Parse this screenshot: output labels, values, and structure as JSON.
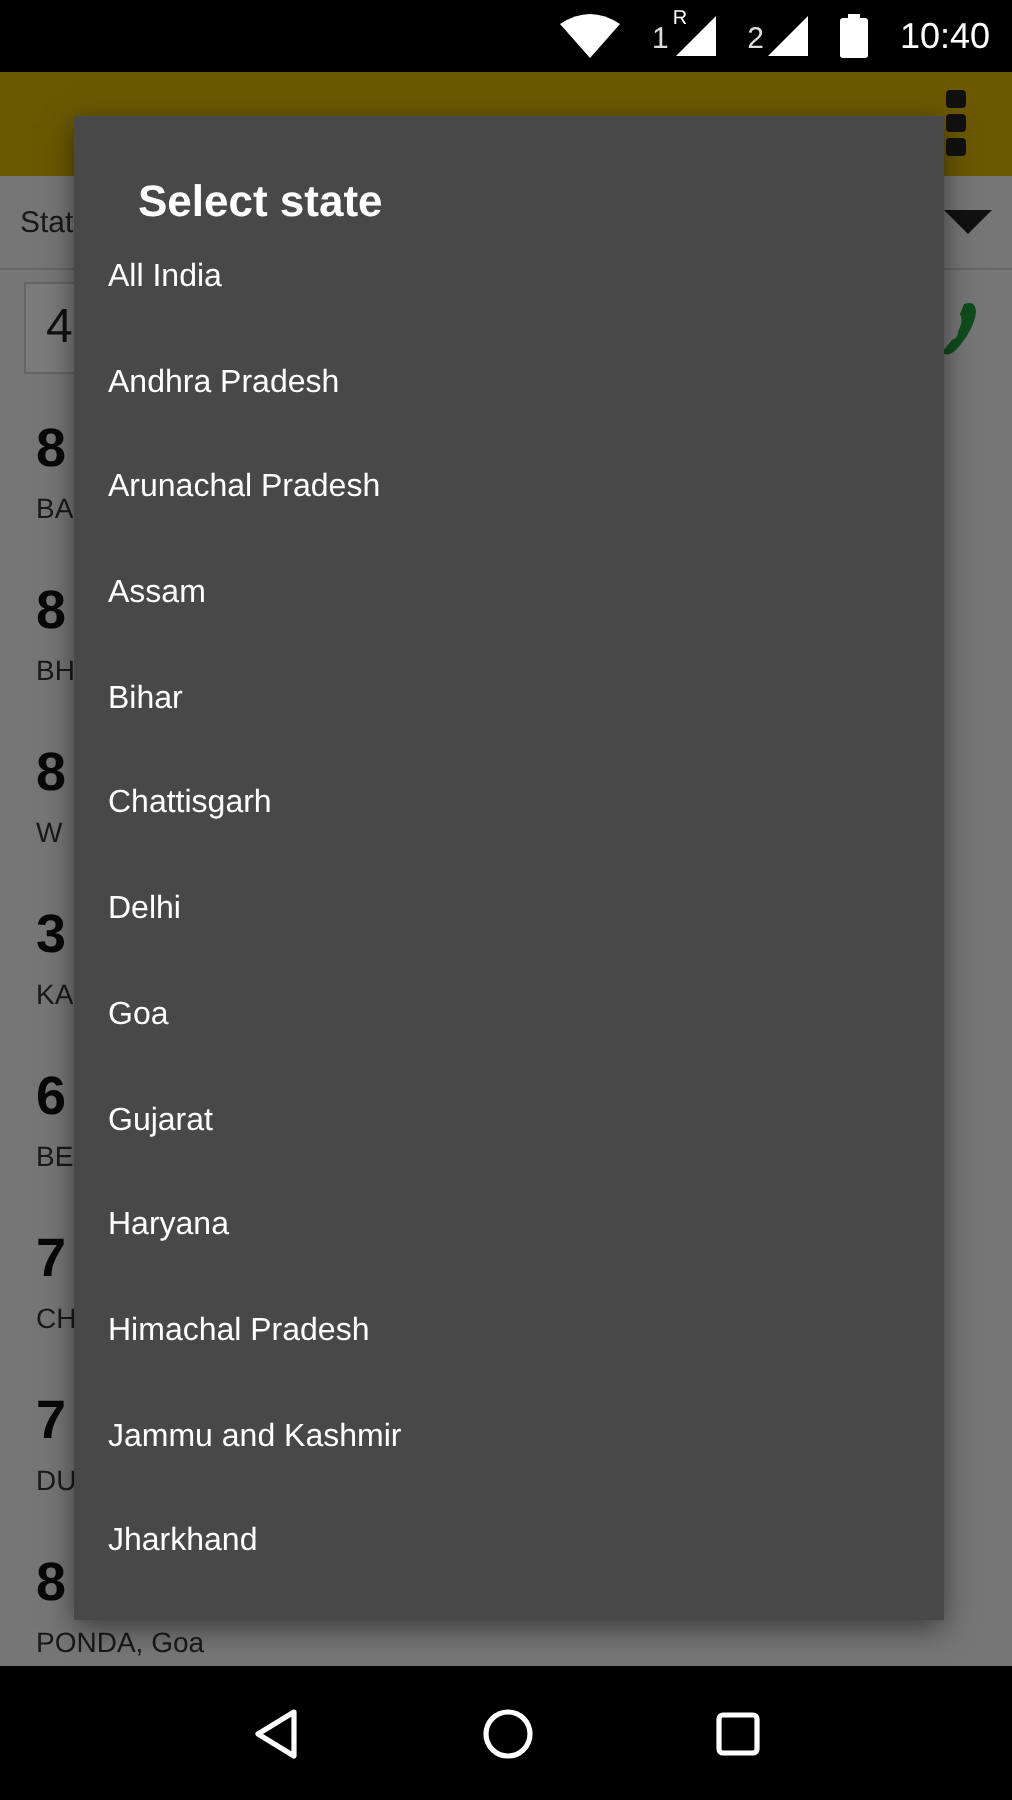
{
  "status_bar": {
    "sim1": "1",
    "roaming": "R",
    "sim2": "2",
    "time": "10:40"
  },
  "state_row": {
    "label": "Stat"
  },
  "search": {
    "value": "4"
  },
  "results": [
    {
      "code": "8",
      "place": "BA"
    },
    {
      "code": "8",
      "place": "BH"
    },
    {
      "code": "8",
      "place": "W"
    },
    {
      "code": "3",
      "place": "KA"
    },
    {
      "code": "6",
      "place": "BE"
    },
    {
      "code": "7",
      "place": "CH"
    },
    {
      "code": "7",
      "place": "DU"
    },
    {
      "code": "8",
      "place": "PONDA, Goa"
    }
  ],
  "dialog": {
    "title": "Select state",
    "items": [
      "All India",
      "Andhra Pradesh",
      "Arunachal Pradesh",
      "Assam",
      "Bihar",
      "Chattisgarh",
      "Delhi",
      "Goa",
      "Gujarat",
      "Haryana",
      "Himachal Pradesh",
      "Jammu and Kashmir",
      "Jharkhand"
    ]
  }
}
